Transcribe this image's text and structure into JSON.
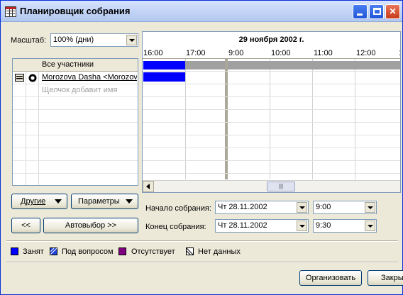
{
  "window": {
    "title": "Планировщик собрания"
  },
  "zoom": {
    "label": "Масштаб:",
    "value": "100% (дни)"
  },
  "attendees": {
    "header": "Все участники",
    "rows": [
      {
        "name": "Morozova Dasha <Morozova"
      },
      {
        "name": "Щелчок добавит имя"
      }
    ]
  },
  "schedule": {
    "date": "29 ноября 2002 г.",
    "times": [
      "16:00",
      "17:00",
      "9:00",
      "10:00",
      "11:00",
      "12:00",
      "1"
    ]
  },
  "buttons": {
    "others": "Другие",
    "options": "Параметры",
    "prev": "<<",
    "autopick": "Автовыбор >>",
    "organize": "Организовать",
    "close": "Закры"
  },
  "meeting": {
    "start_label": "Начало собрания:",
    "start_date": "Чт 28.11.2002",
    "start_time": "9:00",
    "end_label": "Конец собрания:",
    "end_date": "Чт 28.11.2002",
    "end_time": "9:30"
  },
  "legend": [
    {
      "label": "Занят",
      "color": "#0000ff",
      "icon": "busy-swatch"
    },
    {
      "label": "Под вопросом",
      "color": "#3a5fcd",
      "icon": "tentative-swatch"
    },
    {
      "label": "Отсутствует",
      "color": "#800080",
      "icon": "out-of-office-swatch"
    },
    {
      "label": "Нет данных",
      "color": "#ffffff",
      "icon": "no-info-swatch"
    }
  ]
}
